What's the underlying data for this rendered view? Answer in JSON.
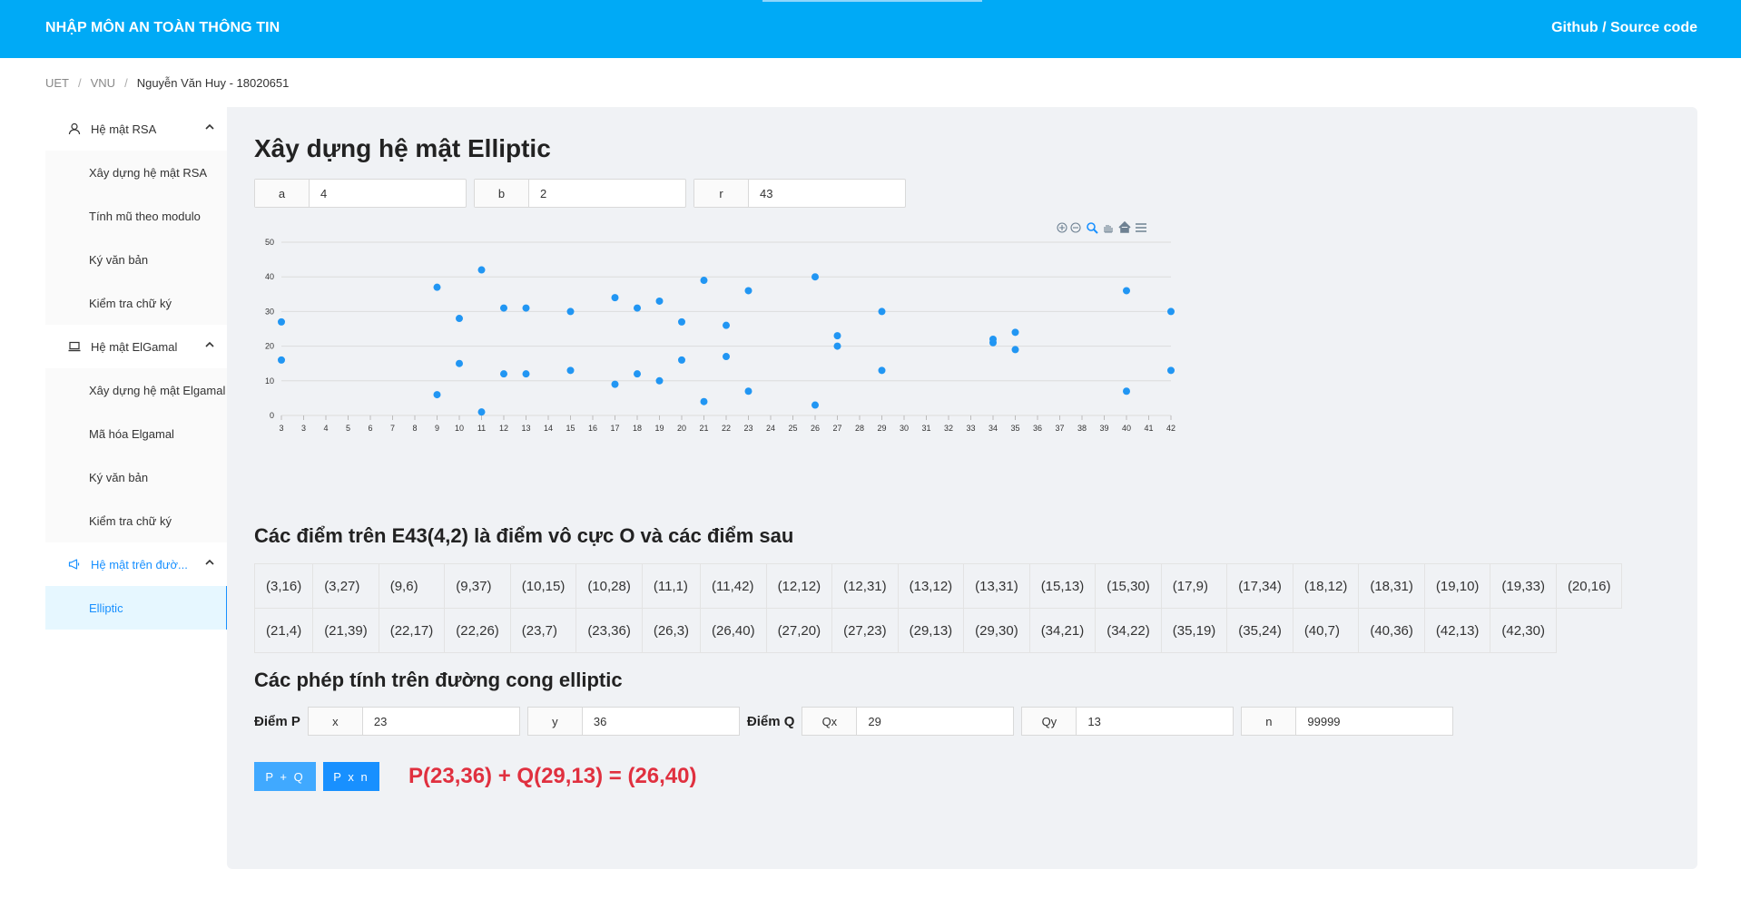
{
  "header": {
    "title": "NHẬP MÔN AN TOÀN THÔNG TIN",
    "link": "Github / Source code"
  },
  "breadcrumb": [
    "UET",
    "VNU",
    "Nguyễn Văn Huy - 18020651"
  ],
  "sidebar": {
    "groups": [
      {
        "label": "Hệ mật RSA",
        "icon": "user-icon",
        "items": [
          "Xây dựng hệ mật RSA",
          "Tính mũ theo modulo",
          "Ký văn bản",
          "Kiểm tra chữ ký"
        ]
      },
      {
        "label": "Hệ mật ElGamal",
        "icon": "laptop-icon",
        "items": [
          "Xây dựng hệ mật Elgamal",
          "Mã hóa Elgamal",
          "Ký văn bản",
          "Kiểm tra chữ ký"
        ]
      },
      {
        "label": "Hệ mật trên đườ...",
        "icon": "notification-icon",
        "items": [
          "Elliptic"
        ]
      }
    ]
  },
  "main": {
    "title": "Xây dựng hệ mật Elliptic",
    "params": {
      "a_label": "a",
      "a": "4",
      "b_label": "b",
      "b": "2",
      "r_label": "r",
      "r": "43"
    },
    "points_title": "Các điểm trên E43(4,2) là điểm vô cực O và các điểm sau",
    "points_row1": [
      "(3,16)",
      "(3,27)",
      "(9,6)",
      "(9,37)",
      "(10,15)",
      "(10,28)",
      "(11,1)",
      "(11,42)",
      "(12,12)",
      "(12,31)",
      "(13,12)",
      "(13,31)",
      "(15,13)",
      "(15,30)",
      "(17,9)",
      "(17,34)",
      "(18,12)",
      "(18,31)",
      "(19,10)",
      "(19,33)",
      "(20,16)"
    ],
    "points_row2": [
      "(21,4)",
      "(21,39)",
      "(22,17)",
      "(22,26)",
      "(23,7)",
      "(23,36)",
      "(26,3)",
      "(26,40)",
      "(27,20)",
      "(27,23)",
      "(29,13)",
      "(29,30)",
      "(34,21)",
      "(34,22)",
      "(35,19)",
      "(35,24)",
      "(40,7)",
      "(40,36)",
      "(42,13)",
      "(42,30)"
    ],
    "ops_title": "Các phép tính trên đường cong elliptic",
    "ops": {
      "p_label": "Điểm P",
      "x_label": "x",
      "x": "23",
      "y_label": "y",
      "y": "36",
      "q_label": "Điểm Q",
      "qx_label": "Qx",
      "qx": "29",
      "qy_label": "Qy",
      "qy": "13",
      "n_label": "n",
      "n": "99999"
    },
    "btn_add": "P + Q",
    "btn_mul": "P x n",
    "result": "P(23,36) + Q(29,13) = (26,40)"
  },
  "colors": {
    "header": "#00aaf6",
    "point": "#2196f3",
    "btn_add": "#40a9ff",
    "btn_mul": "#1890ff",
    "result": "#e0303f"
  },
  "chart_data": {
    "type": "scatter",
    "xlabel": "",
    "ylabel": "",
    "x_ticks": [
      "3",
      "3",
      "4",
      "5",
      "6",
      "7",
      "8",
      "9",
      "10",
      "11",
      "12",
      "13",
      "14",
      "15",
      "16",
      "17",
      "18",
      "19",
      "20",
      "21",
      "22",
      "23",
      "24",
      "25",
      "26",
      "27",
      "28",
      "29",
      "30",
      "31",
      "32",
      "33",
      "34",
      "35",
      "36",
      "37",
      "38",
      "39",
      "40",
      "41",
      "42"
    ],
    "y_ticks": [
      "0",
      "10",
      "20",
      "30",
      "40",
      "50"
    ],
    "ylim": [
      0,
      50
    ],
    "series": [
      {
        "points": [
          [
            3,
            16
          ],
          [
            3,
            27
          ],
          [
            9,
            6
          ],
          [
            9,
            37
          ],
          [
            10,
            15
          ],
          [
            10,
            28
          ],
          [
            11,
            1
          ],
          [
            11,
            42
          ],
          [
            12,
            12
          ],
          [
            12,
            31
          ],
          [
            13,
            12
          ],
          [
            13,
            31
          ],
          [
            15,
            13
          ],
          [
            15,
            30
          ],
          [
            17,
            9
          ],
          [
            17,
            34
          ],
          [
            18,
            12
          ],
          [
            18,
            31
          ],
          [
            19,
            10
          ],
          [
            19,
            33
          ],
          [
            20,
            16
          ],
          [
            20,
            27
          ],
          [
            21,
            4
          ],
          [
            21,
            39
          ],
          [
            22,
            17
          ],
          [
            22,
            26
          ],
          [
            23,
            7
          ],
          [
            23,
            36
          ],
          [
            26,
            3
          ],
          [
            26,
            40
          ],
          [
            27,
            20
          ],
          [
            27,
            23
          ],
          [
            29,
            13
          ],
          [
            29,
            30
          ],
          [
            34,
            21
          ],
          [
            34,
            22
          ],
          [
            35,
            19
          ],
          [
            35,
            24
          ],
          [
            40,
            7
          ],
          [
            40,
            36
          ],
          [
            42,
            13
          ],
          [
            42,
            30
          ]
        ]
      }
    ],
    "toolbar": [
      "zoom-in-icon",
      "zoom-out-icon",
      "magnifier-icon",
      "pan-hand-icon",
      "home-icon",
      "menu-icon"
    ]
  }
}
